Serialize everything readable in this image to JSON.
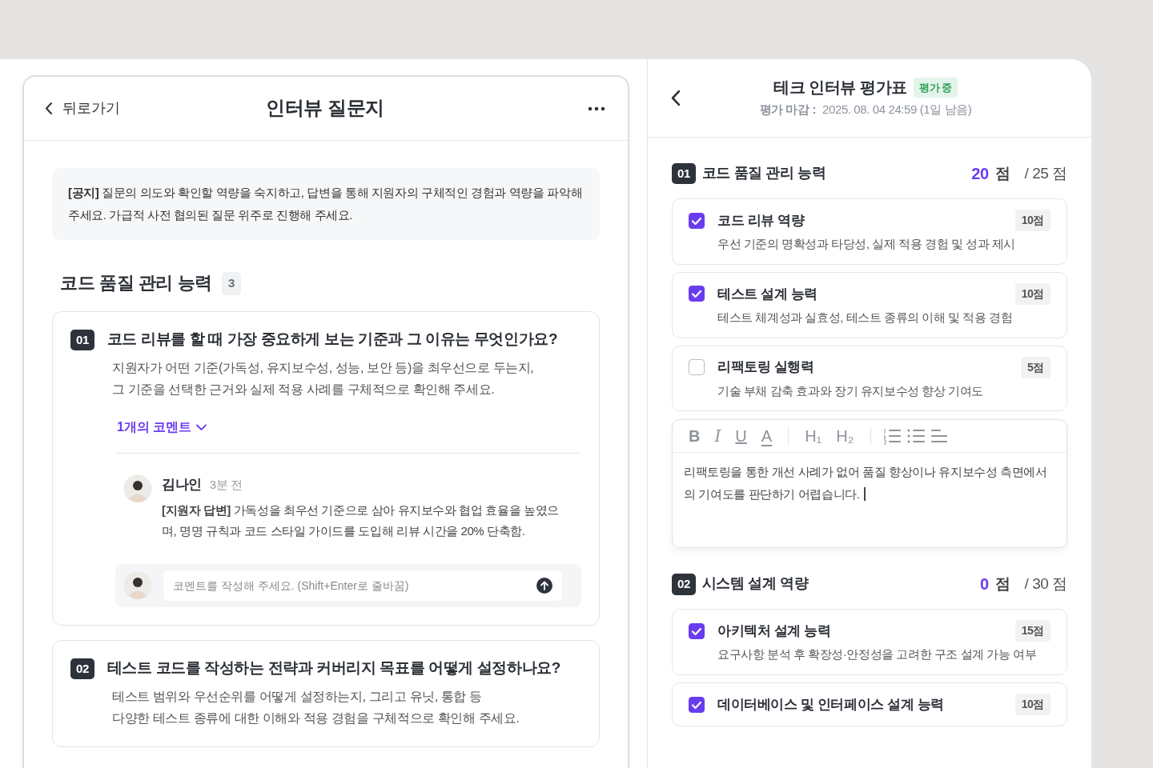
{
  "question_sheet": {
    "back_label": "뒤로가기",
    "title": "인터뷰 질문지",
    "notice": "**[공지]** 질문의 의도와 확인할 역량을 숙지하고, 답변을 통해 지원자의 구체적인 경험과 역량을 파악해 주세요. 가급적 사전 협의된 질문 위주로 진행해 주세요.",
    "section": {
      "title": "코드 품질 관리 능력",
      "count": "3"
    },
    "questions": [
      {
        "number": "01",
        "title": "코드 리뷰를 할 때 가장 중요하게 보는 기준과 그 이유는 무엇인가요?",
        "guide_lines": [
          "지원자가 어떤 기준(가독성, 유지보수성, 성능, 보안 등)을 최우선으로 두는지,",
          "그 기준을 선택한 근거와 실제 적용 사례를 구체적으로 확인해 주세요."
        ],
        "comments_toggle": {
          "label": "1개의 코멘트",
          "expanded": true
        },
        "comments": [
          {
            "author": "김나인",
            "time": "3분 전",
            "text": "**[지원자 답변]** 가독성을 최우선 기준으로 삼아 유지보수와 협업 효율을 높였으며, 명명 규칙과 코드 스타일 가이드를 도입해 리뷰 시간을 20% 단축함."
          }
        ],
        "comment_input": {
          "placeholder": "코멘트를 작성해 주세요. (Shift+Enter로 줄바꿈)"
        }
      },
      {
        "number": "02",
        "title": "테스트 코드를 작성하는 전략과 커버리지 목표를 어떻게 설정하나요?",
        "guide_lines": [
          "테스트 범위와 우선순위를 어떻게 설정하는지, 그리고 유닛, 통합 등",
          "다양한 테스트 종류에 대한 이해와 적용 경험을 구체적으로 확인해 주세요."
        ]
      }
    ]
  },
  "evaluation": {
    "title": "테크 인터뷰 평가표",
    "status": "평가 중",
    "deadline_label": "평가 마감 :",
    "deadline": "2025. 08. 04 24:59 (1일 남음)",
    "sections": [
      {
        "number": "01",
        "title": "코드 품질 관리 능력",
        "score": "20",
        "score_unit": "점",
        "total": "/ 25 점",
        "criteria": [
          {
            "title": "코드 리뷰 역량",
            "points": "10점",
            "description": "우선 기준의 명확성과 타당성, 실제 적용 경험 및 성과 제시",
            "checked": true
          },
          {
            "title": "테스트 설계 능력",
            "points": "10점",
            "description": "테스트 체계성과 실효성, 테스트 종류의 이해 및 적용 경험",
            "checked": true
          },
          {
            "title": "리팩토링 실행력",
            "points": "5점",
            "description": "기술 부채 감축 효과와 장기 유지보수성 향상 기여도",
            "checked": false
          }
        ],
        "editor": {
          "format_buttons": [
            "B",
            "I",
            "U",
            "A"
          ],
          "heading_buttons": [
            "H₁",
            "H₂"
          ],
          "value": "리팩토링을 통한 개선 사례가 없어 품질 향상이나 유지보수성 측면에서의 기여도를 판단하기 어렵습니다. "
        }
      },
      {
        "number": "02",
        "title": "시스템 설계 역량",
        "score": "0",
        "score_unit": "점",
        "total": "/ 30 점",
        "criteria": [
          {
            "title": "아키텍처 설계 능력",
            "points": "15점",
            "description": "요구사항 분석 후 확장성·안정성을 고려한 구조 설계 가능 여부",
            "checked": true
          },
          {
            "title": "데이터베이스 및 인터페이스 설계 능력",
            "points": "10점",
            "checked": true
          }
        ]
      }
    ]
  }
}
